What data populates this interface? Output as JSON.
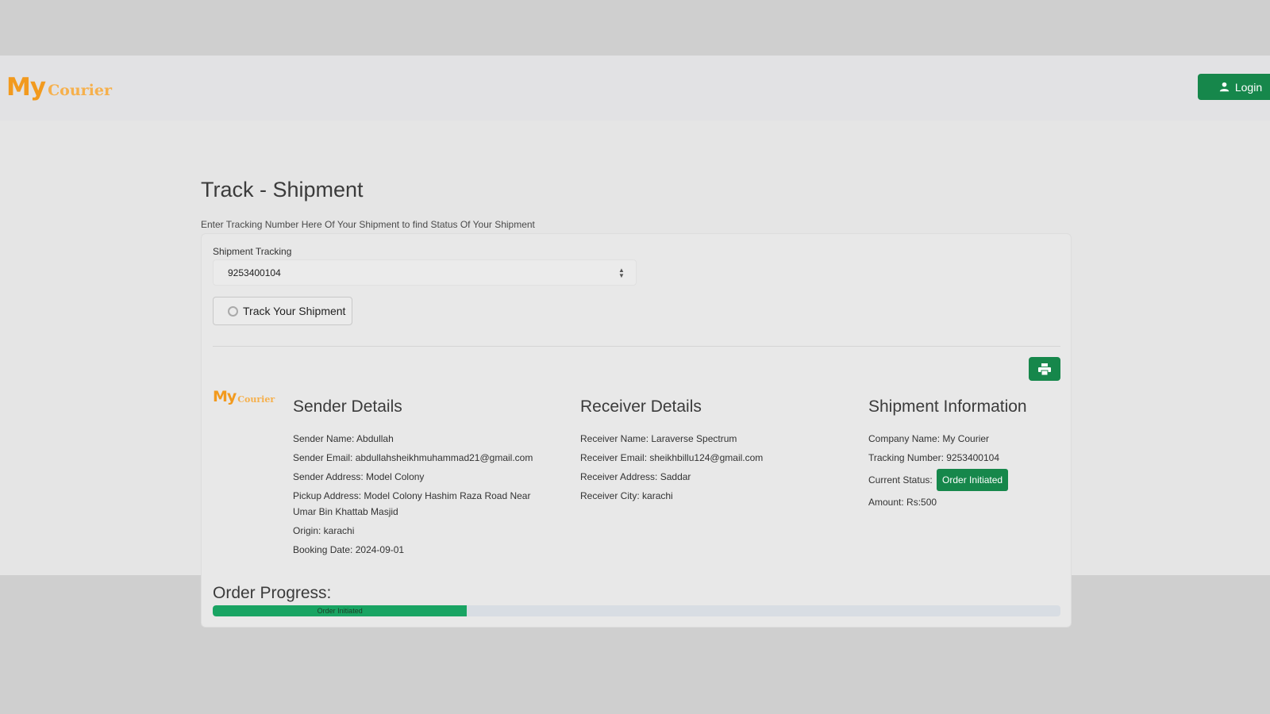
{
  "brand": {
    "my": "My",
    "courier": "Courier"
  },
  "nav": {
    "login_label": "Login"
  },
  "page": {
    "title": "Track - Shipment",
    "subtitle": "Enter Tracking Number Here Of Your Shipment to find Status Of Your Shipment"
  },
  "tracking": {
    "label": "Shipment Tracking",
    "value": "9253400104",
    "button_label": "Track Your Shipment"
  },
  "sender": {
    "heading": "Sender Details",
    "name": "Sender Name: Abdullah",
    "email": "Sender Email: abdullahsheikhmuhammad21@gmail.com",
    "address": "Sender Address: Model Colony",
    "pickup": "Pickup Address: Model Colony Hashim Raza Road Near Umar Bin Khattab Masjid",
    "origin": "Origin: karachi",
    "booking_date": "Booking Date: 2024-09-01"
  },
  "receiver": {
    "heading": "Receiver Details",
    "name": "Receiver Name: Laraverse Spectrum",
    "email": "Receiver Email: sheikhbillu124@gmail.com",
    "address": "Receiver Address: Saddar",
    "city": "Receiver City: karachi"
  },
  "shipment": {
    "heading": "Shipment Information",
    "company": "Company Name: My Courier",
    "tracking_number": "Tracking Number: 9253400104",
    "status_label": "Current Status:",
    "status_value": "Order Initiated",
    "amount": "Amount: Rs:500"
  },
  "progress": {
    "title": "Order Progress:",
    "label": "Order Initiated",
    "percent": 30
  },
  "colors": {
    "accent": "#16874b",
    "progress": "#19a463",
    "logo": "#f29a1e"
  },
  "icons": {
    "login": "user-icon",
    "track": "spinner-icon",
    "print": "print-icon"
  }
}
